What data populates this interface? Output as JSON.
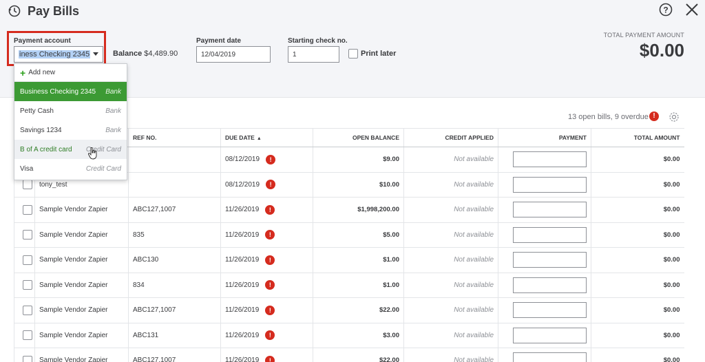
{
  "header": {
    "title": "Pay Bills",
    "total_label": "TOTAL PAYMENT AMOUNT",
    "total_amount": "$0.00"
  },
  "form": {
    "payment_account_label": "Payment account",
    "payment_account_value": "iness Checking 2345",
    "balance_label": "Balance",
    "balance_value": "$4,489.90",
    "payment_date_label": "Payment date",
    "payment_date_value": "12/04/2019",
    "starting_check_label": "Starting check no.",
    "starting_check_value": "1",
    "print_later_label": "Print later"
  },
  "dropdown": {
    "add_new": "Add new",
    "items": [
      {
        "name": "Business Checking 2345",
        "type": "Bank"
      },
      {
        "name": "Petty Cash",
        "type": "Bank"
      },
      {
        "name": "Savings 1234",
        "type": "Bank"
      },
      {
        "name": "B of A credit card",
        "type": "Credit Card"
      },
      {
        "name": "Visa",
        "type": "Credit Card"
      }
    ]
  },
  "summary": {
    "text": "13 open bills, 9 overdue",
    "badge": "!"
  },
  "table": {
    "columns": {
      "payee": "",
      "ref": "REF NO.",
      "due": "DUE DATE",
      "open": "OPEN BALANCE",
      "credit": "CREDIT APPLIED",
      "payment": "PAYMENT",
      "total": "TOTAL AMOUNT"
    },
    "rows": [
      {
        "payee": "",
        "ref": "",
        "due": "08/12/2019",
        "open": "$9.00",
        "credit": "Not available",
        "total": "$0.00"
      },
      {
        "payee": "tony_test",
        "ref": "",
        "due": "08/12/2019",
        "open": "$10.00",
        "credit": "Not available",
        "total": "$0.00"
      },
      {
        "payee": "Sample Vendor Zapier",
        "ref": "ABC127,1007",
        "due": "11/26/2019",
        "open": "$1,998,200.00",
        "credit": "Not available",
        "total": "$0.00"
      },
      {
        "payee": "Sample Vendor Zapier",
        "ref": "835",
        "due": "11/26/2019",
        "open": "$5.00",
        "credit": "Not available",
        "total": "$0.00"
      },
      {
        "payee": "Sample Vendor Zapier",
        "ref": "ABC130",
        "due": "11/26/2019",
        "open": "$1.00",
        "credit": "Not available",
        "total": "$0.00"
      },
      {
        "payee": "Sample Vendor Zapier",
        "ref": "834",
        "due": "11/26/2019",
        "open": "$1.00",
        "credit": "Not available",
        "total": "$0.00"
      },
      {
        "payee": "Sample Vendor Zapier",
        "ref": "ABC127,1007",
        "due": "11/26/2019",
        "open": "$22.00",
        "credit": "Not available",
        "total": "$0.00"
      },
      {
        "payee": "Sample Vendor Zapier",
        "ref": "ABC131",
        "due": "11/26/2019",
        "open": "$3.00",
        "credit": "Not available",
        "total": "$0.00"
      },
      {
        "payee": "Sample Vendor Zapier",
        "ref": "ABC127,1007",
        "due": "11/26/2019",
        "open": "$22.00",
        "credit": "Not available",
        "total": "$0.00"
      }
    ]
  },
  "colors": {
    "accent_green": "#2ca01c",
    "selected_green": "#3c9a34",
    "overdue_red": "#d52b1e",
    "highlight_box": "#d52b1e"
  },
  "icons": [
    "history-icon",
    "help-icon",
    "close-icon",
    "settings-icon",
    "overdue-icon",
    "chevron-down-icon",
    "plus-icon",
    "cursor-icon"
  ]
}
